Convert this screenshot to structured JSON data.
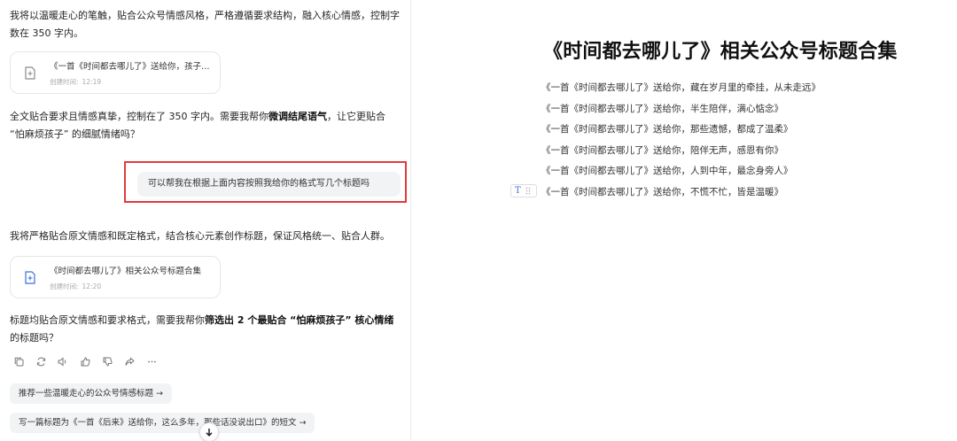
{
  "chat": {
    "intro_text": "我将以温暖走心的笔触，贴合公众号情感风格，严格遵循要求结构，融入核心情感，控制字数在 350 字内。",
    "card1": {
      "title": "《一首《时间都去哪儿了》送给你，孩子…",
      "time_label": "创建时间:",
      "time_value": "12:19"
    },
    "reply1": {
      "before": "全文贴合要求且情感真挚，控制在了 350 字内。需要我帮你",
      "bold": "微调结尾语气",
      "after": "，让它更贴合 “怕麻烦孩子” 的细腻情绪吗？"
    },
    "user_message": "可以帮我在根据上面内容按照我给你的格式写几个标题吗",
    "reply2_text": "我将严格贴合原文情感和既定格式，结合核心元素创作标题，保证风格统一、贴合人群。",
    "card2": {
      "title": "《时间都去哪儿了》相关公众号标题合集",
      "time_label": "创建时间:",
      "time_value": "12:20"
    },
    "reply3": {
      "before": "标题均贴合原文情感和要求格式，需要我帮你",
      "bold": "筛选出 2 个最贴合 “怕麻烦孩子” 核心情绪",
      "after": "的标题吗？"
    },
    "action_icons": [
      "copy-icon",
      "regenerate-icon",
      "speaker-icon",
      "thumbs-up-icon",
      "thumbs-down-icon",
      "share-icon",
      "more-icon"
    ],
    "suggestions": [
      "推荐一些温暖走心的公众号情感标题 →",
      "写一篇标题为《一首《后来》送给你，这么多年，那些话没说出口》的短文 →"
    ]
  },
  "document": {
    "title": "《时间都去哪儿了》相关公众号标题合集",
    "items": [
      "《一首《时间都去哪儿了》送给你，藏在岁月里的牵挂，从未走远》",
      "《一首《时间都去哪儿了》送给你，半生陪伴，满心惦念》",
      "《一首《时间都去哪儿了》送给你，那些遗憾，都成了温柔》",
      "《一首《时间都去哪儿了》送给你，陪伴无声，感恩有你》",
      "《一首《时间都去哪儿了》送给你，人到中年，最念身旁人》",
      "《一首《时间都去哪儿了》送给你，不慌不忙，皆是温暖》"
    ],
    "block_handle_letter": "T"
  },
  "colors": {
    "highlight_red": "#e23b3b",
    "doc_icon_gray": "#8a8a8a",
    "doc_icon_blue": "#3b6fd9"
  }
}
